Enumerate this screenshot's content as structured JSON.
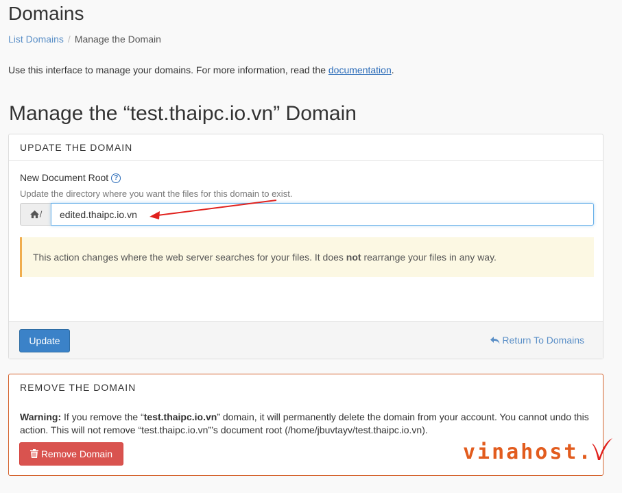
{
  "header": {
    "title": "Domains",
    "breadcrumb": {
      "list_domains": "List Domains",
      "separator": "/",
      "current": "Manage the Domain"
    },
    "intro_text": "Use this interface to manage your domains. For more information, read the",
    "intro_link": "documentation",
    "intro_end": "."
  },
  "manage_title": "Manage the “test.thaipc.io.vn” Domain",
  "update_panel": {
    "heading": "UPDATE THE DOMAIN",
    "field_label": "New Document Root",
    "help_icon": "?",
    "help_text": "Update the directory where you want the files for this domain to exist.",
    "addon_icon": "home-icon",
    "addon_slash": "/",
    "input_value": "edited.thaipc.io.vn",
    "alert_before": "This action changes where the web server searches for your files. It does",
    "alert_bold": "not",
    "alert_after": "rearrange your files in any way.",
    "update_button": "Update",
    "return_link": "Return To Domains"
  },
  "remove_panel": {
    "heading": "REMOVE THE DOMAIN",
    "warning_label": "Warning:",
    "warning_part1": "If you remove the “",
    "warning_domain": "test.thaipc.io.vn",
    "warning_part2": "” domain, it will permanently delete the domain from your account. You cannot undo this action. This will not remove “test.thaipc.io.vn”’s document root (/home/jbuvtayv/test.thaipc.io.vn).",
    "remove_button": "Remove Domain"
  },
  "watermark": "vinahost.",
  "colors": {
    "accent": "#3b82c8",
    "danger": "#d9534f",
    "warning_bg": "#fcf8e3",
    "annotation_arrow": "#e0211d"
  }
}
